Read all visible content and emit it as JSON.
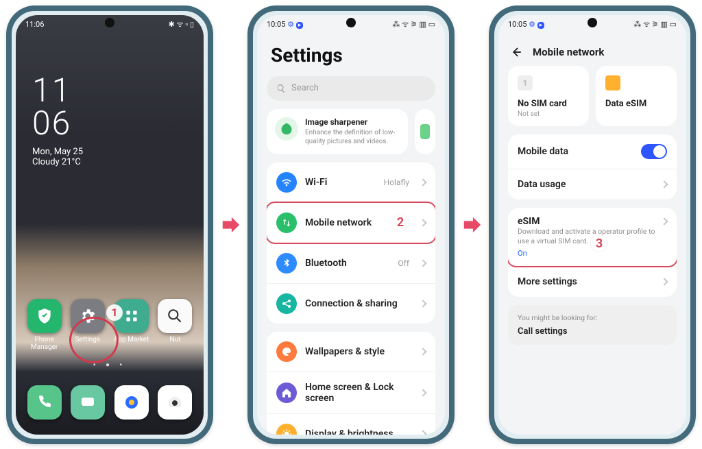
{
  "screen1": {
    "status_time": "11:06",
    "status_icons": "✱ ᯤ ▫ ▯",
    "clock_top": "11",
    "clock_bottom": "06",
    "date_line": "Mon, May 25",
    "weather_line": "Cloudy 21°C",
    "apps": {
      "phone_manager": "Phone\nManager",
      "settings": "Settings",
      "app_market": "App Market",
      "nut": "Nut"
    },
    "badge": "1",
    "page_dots": "▪ ● ▪"
  },
  "screen2": {
    "status_time": "10:05",
    "title": "Settings",
    "search_placeholder": "Search",
    "promo": {
      "title": "Image sharpener",
      "desc": "Enhance the definition of low-quality pictures and videos."
    },
    "rows": {
      "wifi": "Wi-Fi",
      "wifi_val": "Holafly",
      "mobile": "Mobile network",
      "bluetooth": "Bluetooth",
      "bluetooth_val": "Off",
      "connection": "Connection & sharing",
      "wallpapers": "Wallpapers & style",
      "homescreen": "Home screen & Lock screen",
      "display": "Display & brightness"
    },
    "badge": "2"
  },
  "screen3": {
    "status_time": "10:05",
    "header": "Mobile network",
    "sim1_label": "No SIM card",
    "sim1_sub": "Not set",
    "sim2_label": "Data eSIM",
    "rows": {
      "mobile_data": "Mobile data",
      "data_usage": "Data usage",
      "esim": "eSIM",
      "esim_desc": "Download and activate a operator profile to use a virtual SIM card.",
      "esim_state": "On",
      "more": "More settings"
    },
    "hint_label": "You might be looking for:",
    "hint_item": "Call settings",
    "badge": "3"
  }
}
